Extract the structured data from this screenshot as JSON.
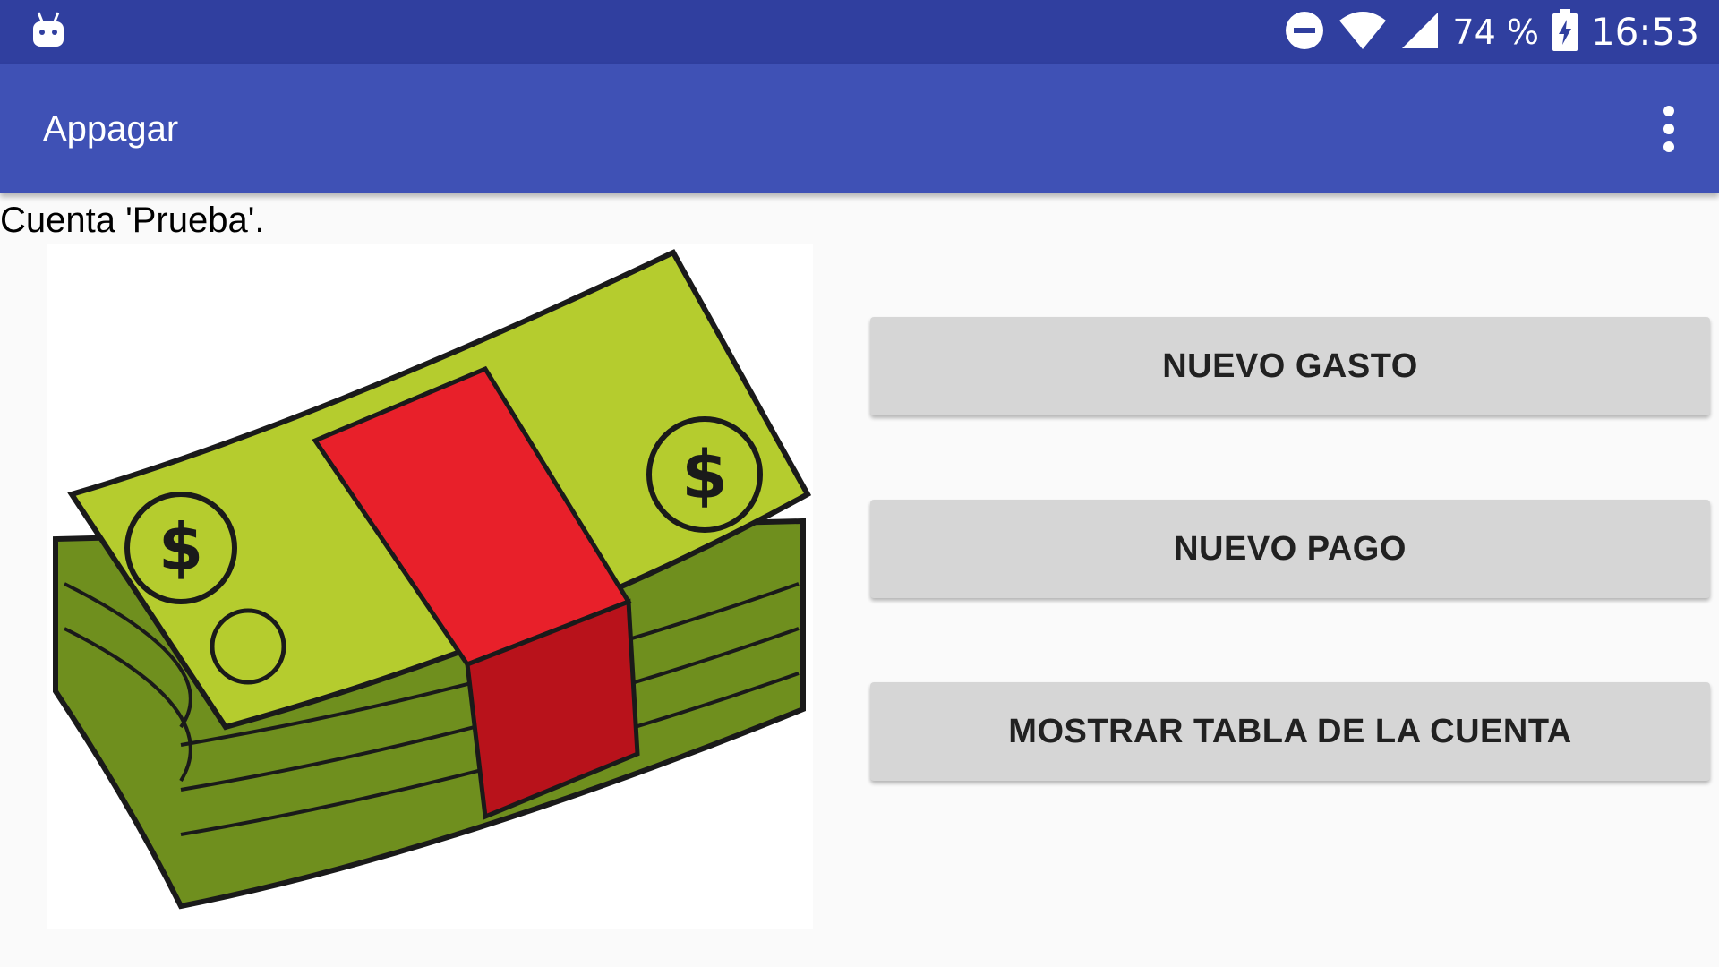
{
  "status_bar": {
    "battery_percent": "74 %",
    "time": "16:53",
    "icons": [
      "android-debug-icon",
      "do-not-disturb-icon",
      "wifi-icon",
      "cell-signal-icon",
      "battery-charging-icon"
    ]
  },
  "app_bar": {
    "title": "Appagar",
    "menu_icon": "more-vert-icon"
  },
  "main": {
    "account_label": "Cuenta 'Prueba'.",
    "image_icon": "money-stack-image",
    "buttons": [
      {
        "label": "NUEVO GASTO"
      },
      {
        "label": "NUEVO PAGO"
      },
      {
        "label": "MOSTRAR TABLA DE LA CUENTA"
      }
    ]
  },
  "colors": {
    "status_bar": "#303f9f",
    "app_bar": "#3f51b5",
    "background": "#fafafa",
    "button": "#d6d6d6",
    "button_text": "#212121",
    "bill_green": "#b5cc2e",
    "band_red": "#e8202a"
  }
}
